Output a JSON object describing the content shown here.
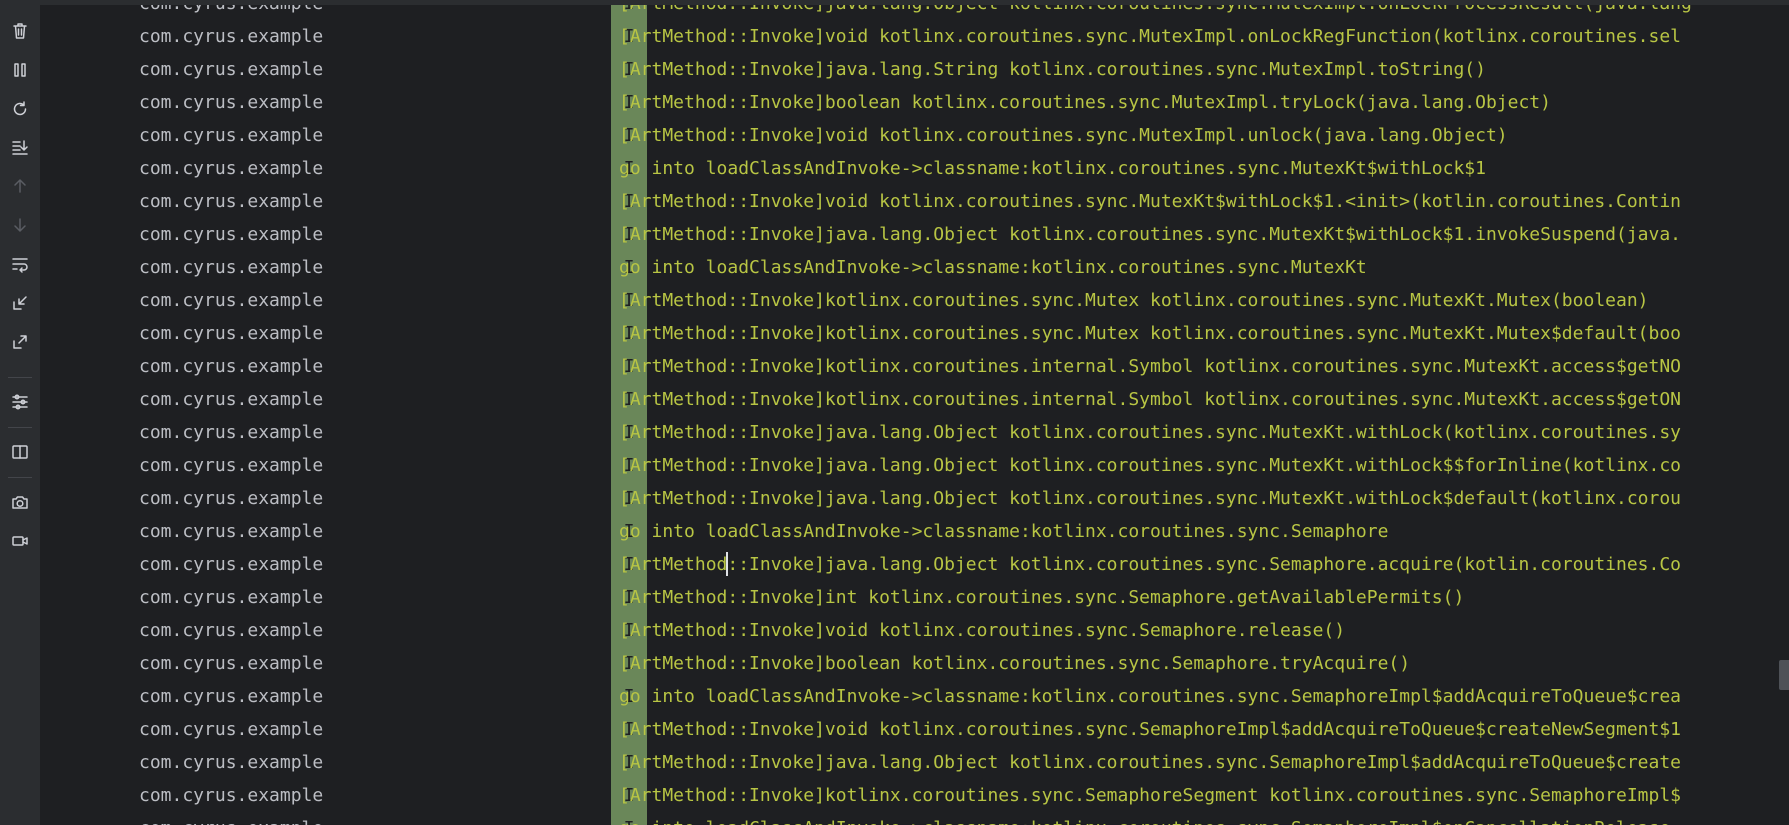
{
  "toolbar": {
    "items": [
      {
        "icon": "trash-icon",
        "action": "clear-logcat",
        "enabled": true
      },
      {
        "icon": "pause-icon",
        "action": "pause",
        "enabled": true
      },
      {
        "icon": "restart-icon",
        "action": "restart",
        "enabled": true
      },
      {
        "icon": "scroll-to-end-icon",
        "action": "scroll-to-end",
        "enabled": true
      },
      {
        "icon": "arrow-up-icon",
        "action": "previous-occurrence",
        "enabled": false
      },
      {
        "icon": "arrow-down-icon",
        "action": "next-occurrence",
        "enabled": false
      },
      {
        "icon": "soft-wrap-icon",
        "action": "soft-wrap",
        "enabled": true
      },
      {
        "icon": "fold-icon",
        "action": "fold",
        "enabled": true
      },
      {
        "icon": "unfold-icon",
        "action": "unfold",
        "enabled": true
      },
      {
        "icon": "settings-sliders-icon",
        "action": "logcat-format",
        "enabled": true
      },
      {
        "icon": "split-panels-icon",
        "action": "split-panels",
        "enabled": true
      },
      {
        "icon": "camera-icon",
        "action": "screenshot",
        "enabled": true
      },
      {
        "icon": "video-icon",
        "action": "screen-record",
        "enabled": true
      }
    ]
  },
  "log": {
    "rows": [
      {
        "package": "com.cyrus.example",
        "level": "I",
        "message": "[ArtMethod::Invoke]java.lang.Object kotlinx.coroutines.sync.MutexImpl.onLockProcessResult(java.lang"
      },
      {
        "package": "com.cyrus.example",
        "level": "I",
        "message": "[ArtMethod::Invoke]void kotlinx.coroutines.sync.MutexImpl.onLockRegFunction(kotlinx.coroutines.sel"
      },
      {
        "package": "com.cyrus.example",
        "level": "I",
        "message": "[ArtMethod::Invoke]java.lang.String kotlinx.coroutines.sync.MutexImpl.toString()"
      },
      {
        "package": "com.cyrus.example",
        "level": "I",
        "message": "[ArtMethod::Invoke]boolean kotlinx.coroutines.sync.MutexImpl.tryLock(java.lang.Object)"
      },
      {
        "package": "com.cyrus.example",
        "level": "I",
        "message": "[ArtMethod::Invoke]void kotlinx.coroutines.sync.MutexImpl.unlock(java.lang.Object)"
      },
      {
        "package": "com.cyrus.example",
        "level": "I",
        "message": "go into loadClassAndInvoke->classname:kotlinx.coroutines.sync.MutexKt$withLock$1"
      },
      {
        "package": "com.cyrus.example",
        "level": "I",
        "message": "[ArtMethod::Invoke]void kotlinx.coroutines.sync.MutexKt$withLock$1.<init>(kotlin.coroutines.Contin"
      },
      {
        "package": "com.cyrus.example",
        "level": "I",
        "message": "[ArtMethod::Invoke]java.lang.Object kotlinx.coroutines.sync.MutexKt$withLock$1.invokeSuspend(java."
      },
      {
        "package": "com.cyrus.example",
        "level": "I",
        "message": "go into loadClassAndInvoke->classname:kotlinx.coroutines.sync.MutexKt"
      },
      {
        "package": "com.cyrus.example",
        "level": "I",
        "message": "[ArtMethod::Invoke]kotlinx.coroutines.sync.Mutex kotlinx.coroutines.sync.MutexKt.Mutex(boolean)"
      },
      {
        "package": "com.cyrus.example",
        "level": "I",
        "message": "[ArtMethod::Invoke]kotlinx.coroutines.sync.Mutex kotlinx.coroutines.sync.MutexKt.Mutex$default(boo"
      },
      {
        "package": "com.cyrus.example",
        "level": "I",
        "message": "[ArtMethod::Invoke]kotlinx.coroutines.internal.Symbol kotlinx.coroutines.sync.MutexKt.access$getNO"
      },
      {
        "package": "com.cyrus.example",
        "level": "I",
        "message": "[ArtMethod::Invoke]kotlinx.coroutines.internal.Symbol kotlinx.coroutines.sync.MutexKt.access$getON"
      },
      {
        "package": "com.cyrus.example",
        "level": "I",
        "message": "[ArtMethod::Invoke]java.lang.Object kotlinx.coroutines.sync.MutexKt.withLock(kotlinx.coroutines.sy"
      },
      {
        "package": "com.cyrus.example",
        "level": "I",
        "message": "[ArtMethod::Invoke]java.lang.Object kotlinx.coroutines.sync.MutexKt.withLock$$forInline(kotlinx.co"
      },
      {
        "package": "com.cyrus.example",
        "level": "I",
        "message": "[ArtMethod::Invoke]java.lang.Object kotlinx.coroutines.sync.MutexKt.withLock$default(kotlinx.corou"
      },
      {
        "package": "com.cyrus.example",
        "level": "I",
        "message": "go into loadClassAndInvoke->classname:kotlinx.coroutines.sync.Semaphore"
      },
      {
        "package": "com.cyrus.example",
        "level": "I",
        "message": "[ArtMethod::Invoke]java.lang.Object kotlinx.coroutines.sync.Semaphore.acquire(kotlin.coroutines.Co"
      },
      {
        "package": "com.cyrus.example",
        "level": "I",
        "message": "[ArtMethod::Invoke]int kotlinx.coroutines.sync.Semaphore.getAvailablePermits()"
      },
      {
        "package": "com.cyrus.example",
        "level": "I",
        "message": "[ArtMethod::Invoke]void kotlinx.coroutines.sync.Semaphore.release()"
      },
      {
        "package": "com.cyrus.example",
        "level": "I",
        "message": "[ArtMethod::Invoke]boolean kotlinx.coroutines.sync.Semaphore.tryAcquire()"
      },
      {
        "package": "com.cyrus.example",
        "level": "I",
        "message": "go into loadClassAndInvoke->classname:kotlinx.coroutines.sync.SemaphoreImpl$addAcquireToQueue$crea"
      },
      {
        "package": "com.cyrus.example",
        "level": "I",
        "message": "[ArtMethod::Invoke]void kotlinx.coroutines.sync.SemaphoreImpl$addAcquireToQueue$createNewSegment$1"
      },
      {
        "package": "com.cyrus.example",
        "level": "I",
        "message": "[ArtMethod::Invoke]java.lang.Object kotlinx.coroutines.sync.SemaphoreImpl$addAcquireToQueue$create"
      },
      {
        "package": "com.cyrus.example",
        "level": "I",
        "message": "[ArtMethod::Invoke]kotlinx.coroutines.sync.SemaphoreSegment kotlinx.coroutines.sync.SemaphoreImpl$"
      },
      {
        "package": "com.cyrus.example",
        "level": "I",
        "message": "go into loadClassAndInvoke->classname:kotlinx.coroutines.sync.SemaphoreImpl$onCancellationRelease"
      }
    ]
  },
  "colors": {
    "background": "#1e1f22",
    "toolbar": "#2b2d30",
    "package_text": "#bcbec4",
    "info_level_bg": "#6a8759",
    "info_message_text": "#b8c544"
  }
}
